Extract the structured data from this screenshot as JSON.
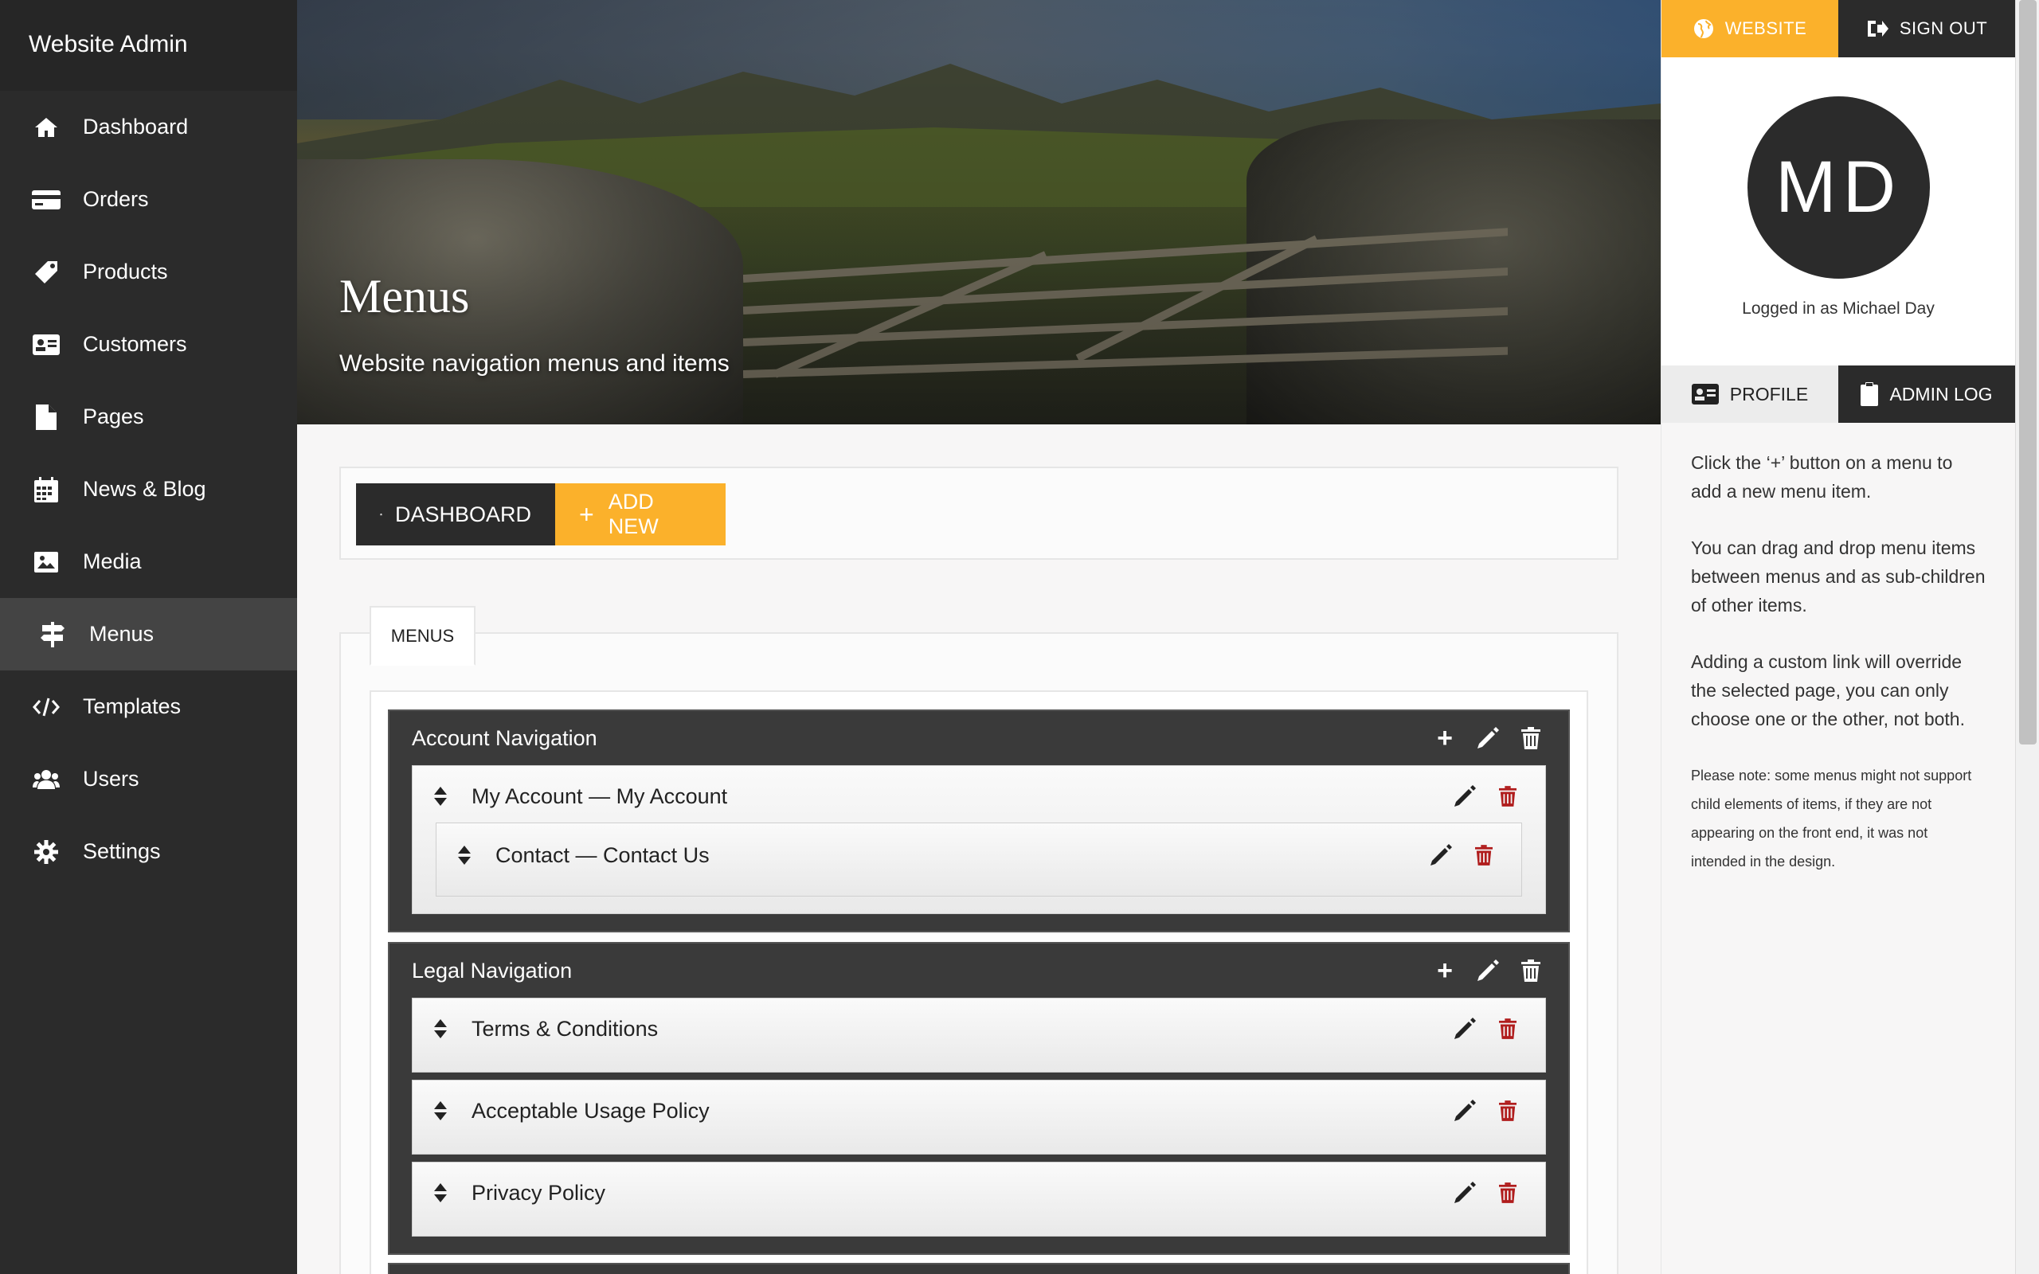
{
  "app": {
    "brand": "Website Admin"
  },
  "sidebar": {
    "items": [
      {
        "label": "Dashboard",
        "icon": "home-icon"
      },
      {
        "label": "Orders",
        "icon": "credit-card-icon"
      },
      {
        "label": "Products",
        "icon": "tag-icon"
      },
      {
        "label": "Customers",
        "icon": "id-card-icon"
      },
      {
        "label": "Pages",
        "icon": "file-icon"
      },
      {
        "label": "News & Blog",
        "icon": "calendar-icon"
      },
      {
        "label": "Media",
        "icon": "image-icon"
      },
      {
        "label": "Menus",
        "icon": "signpost-icon",
        "active": true
      },
      {
        "label": "Templates",
        "icon": "code-icon"
      },
      {
        "label": "Users",
        "icon": "users-icon"
      },
      {
        "label": "Settings",
        "icon": "gear-icon"
      }
    ]
  },
  "hero": {
    "title": "Menus",
    "subtitle": "Website navigation menus and items"
  },
  "toolbar": {
    "dashboard_label": "DASHBOARD",
    "add_label": "ADD NEW",
    "add_symbol": "+"
  },
  "menus_tab": {
    "label": "MENUS"
  },
  "menus": [
    {
      "name": "Account Navigation",
      "items": [
        {
          "label": "My Account — My Account",
          "children": [
            {
              "label": "Contact — Contact Us"
            }
          ]
        }
      ]
    },
    {
      "name": "Legal Navigation",
      "items": [
        {
          "label": "Terms & Conditions"
        },
        {
          "label": "Acceptable Usage Policy"
        },
        {
          "label": "Privacy Policy"
        }
      ]
    }
  ],
  "right_panel": {
    "website_label": "WEBSITE",
    "signout_label": "SIGN OUT",
    "avatar_initials": "MD",
    "logged_in_text": "Logged in as Michael Day",
    "profile_label": "PROFILE",
    "adminlog_label": "ADMIN LOG",
    "help": [
      "Click the ‘+’ button on a menu to add a new menu item.",
      "You can drag and drop menu items between menus and as sub-children of other items.",
      "Adding a custom link will override the selected page, you can only choose one or the other, not both."
    ],
    "note": "Please note: some menus might not support child elements of items, if they are not appearing on the front end, it was not intended in the design."
  },
  "colors": {
    "accent": "#fbb12b",
    "dark": "#2b2b2b",
    "danger": "#b01c1c"
  }
}
